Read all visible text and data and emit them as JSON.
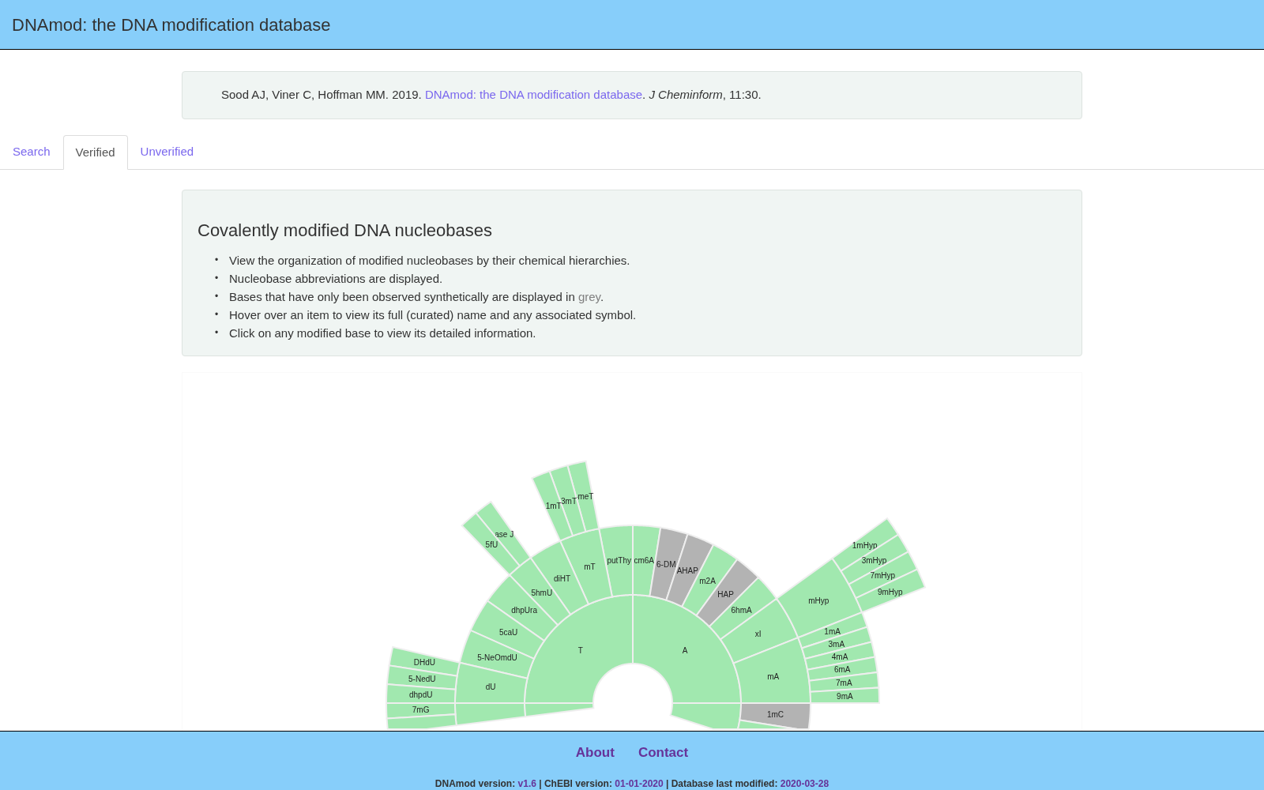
{
  "header": {
    "title": "DNAmod: the DNA modification database"
  },
  "citation": {
    "before": "Sood AJ, Viner C, Hoffman MM. 2019. ",
    "link": "DNAmod: the DNA modification database",
    "after": ". *J Cheminform*, 11:30."
  },
  "tabs": [
    {
      "label": "Search",
      "selected": false
    },
    {
      "label": "Verified",
      "selected": true
    },
    {
      "label": "Unverified",
      "selected": false
    }
  ],
  "info": {
    "heading": "Covalently modified DNA nucleobases",
    "bullets": [
      {
        "marker": "•",
        "text": "View the organization of modified nucleobases by their chemical hierarchies."
      },
      {
        "marker": "•",
        "text": "Nucleobase abbreviations are displayed."
      },
      {
        "marker": "•",
        "text": "Bases that have only been observed synthetically are displayed in ",
        "grey_word": "grey",
        "after": "."
      },
      {
        "marker": "•",
        "text": "Hover over an item to view its full (curated) name and any associated symbol."
      },
      {
        "marker": "•",
        "text": "Click on any modified base to view its detailed information."
      }
    ]
  },
  "sunburst": {
    "segments": [
      {
        "label": "T",
        "synthetic": false,
        "children": [
          {
            "label": "putThy",
            "synthetic": false
          },
          {
            "label": "mT",
            "synthetic": false,
            "children": [
              {
                "label": "-meT",
                "synthetic": false
              },
              {
                "label": "3mT",
                "synthetic": false
              },
              {
                "label": "1mT",
                "synthetic": false
              }
            ]
          },
          {
            "label": "diHT",
            "synthetic": false
          },
          {
            "label": "5hmU",
            "synthetic": false,
            "children": [
              {
                "label": "ase J",
                "synthetic": false
              },
              {
                "label": "5fU",
                "synthetic": false
              }
            ]
          },
          {
            "label": "dhpUra",
            "synthetic": false
          },
          {
            "label": "5caU",
            "synthetic": false
          },
          {
            "label": "5-NeOmdU",
            "synthetic": false
          },
          {
            "label": "dU",
            "synthetic": false,
            "children": [
              {
                "label": "DHdU",
                "synthetic": false
              },
              {
                "label": "5-NedU",
                "synthetic": false
              },
              {
                "label": "dhpdU",
                "synthetic": false
              }
            ]
          }
        ]
      },
      {
        "label": "A",
        "synthetic": false,
        "children": [
          {
            "label": "cm6A",
            "synthetic": false
          },
          {
            "label": "6-DM",
            "synthetic": true
          },
          {
            "label": "AHAP",
            "synthetic": true
          },
          {
            "label": "m2A",
            "synthetic": false
          },
          {
            "label": "HAP",
            "synthetic": true
          },
          {
            "label": "6hmA",
            "synthetic": false
          },
          {
            "label": "xI",
            "synthetic": false,
            "children": [
              {
                "label": "mHyp",
                "synthetic": false,
                "children": [
                  {
                    "label": "1mHyp",
                    "synthetic": false
                  },
                  {
                    "label": "3mHyp",
                    "synthetic": false
                  },
                  {
                    "label": "7mHyp",
                    "synthetic": false
                  },
                  {
                    "label": "9mHyp",
                    "synthetic": false
                  }
                ]
              }
            ]
          },
          {
            "label": "mA",
            "synthetic": false,
            "children": [
              {
                "label": "1mA",
                "synthetic": false
              },
              {
                "label": "3mA",
                "synthetic": false
              },
              {
                "label": "4mA",
                "synthetic": false
              },
              {
                "label": "6mA",
                "synthetic": false
              },
              {
                "label": "7mA",
                "synthetic": false
              },
              {
                "label": "9mA",
                "synthetic": false
              }
            ]
          }
        ]
      },
      {
        "synthetic": false,
        "children": [
          {
            "label": "1mC",
            "synthetic": true
          },
          {
            "synthetic": false
          }
        ]
      },
      {
        "synthetic": false,
        "children": [
          {
            "synthetic": false,
            "children": [
              {
                "label": "7mG",
                "synthetic": false
              },
              {
                "synthetic": false
              }
            ]
          }
        ]
      }
    ]
  },
  "footer": {
    "links": [
      "About",
      "Contact"
    ],
    "separator": "|",
    "versions": [
      {
        "label": "DNAmod version:",
        "value": "v1.6"
      },
      {
        "label": "ChEBI version:",
        "value": "01-01-2020"
      },
      {
        "label": "Database last modified:",
        "value": "2020-03-28"
      }
    ]
  }
}
